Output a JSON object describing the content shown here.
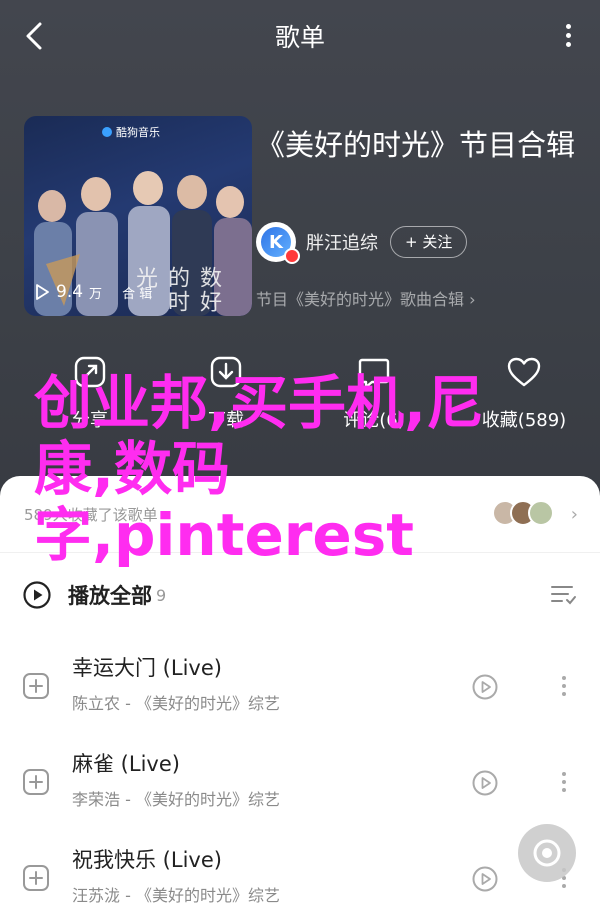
{
  "nav": {
    "title": "歌单"
  },
  "cover": {
    "logo_text": "酷狗音乐",
    "script_text": "数好的时光",
    "play_count_value": "9.4",
    "play_count_unit": "万",
    "extra_label": "合 辑"
  },
  "playlist": {
    "title": "《美好的时光》节目合辑",
    "creator_name": "胖汪追综",
    "follow_label": "+ 关注",
    "subtitle": "节目《美好的时光》歌曲合辑 ›"
  },
  "actions": [
    {
      "label": "分享"
    },
    {
      "label": "下载"
    },
    {
      "label": "评论(6)"
    },
    {
      "label": "收藏(589)"
    }
  ],
  "watermark": {
    "text": "创业邦,买手机,尼康,数码字,pinterest"
  },
  "sheet": {
    "collect_text": "589人收藏了该歌单",
    "play_all_label": "播放全部",
    "play_all_count": "9"
  },
  "songs": [
    {
      "title": "幸运大门 (Live)",
      "meta": "陈立农 - 《美好的时光》综艺"
    },
    {
      "title": "麻雀 (Live)",
      "meta": "李荣浩 - 《美好的时光》综艺"
    },
    {
      "title": "祝我快乐 (Live)",
      "meta": "汪苏泷 - 《美好的时光》综艺"
    }
  ],
  "colors": {
    "accent_watermark": "#ff2cf0",
    "badge": "#ff3a3a",
    "avatar_blue": "#2f74e6"
  }
}
